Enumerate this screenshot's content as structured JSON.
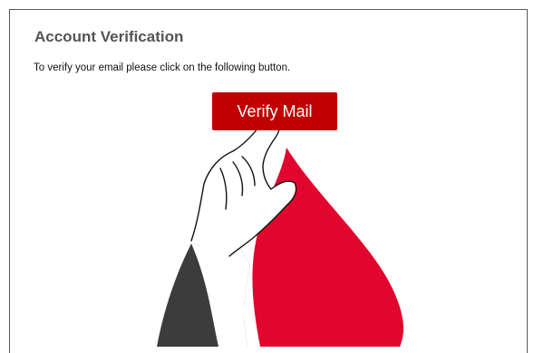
{
  "email": {
    "title": "Account Verification",
    "message": "To verify your email please click on the following button.",
    "button_label": "Verify Mail"
  },
  "illustration": {
    "icons": [
      "flame-shape",
      "pointing-hand-icon"
    ],
    "colors": {
      "flame": "#e0062e",
      "sleeve": "#3c3c3c",
      "button": "#c00000"
    }
  }
}
